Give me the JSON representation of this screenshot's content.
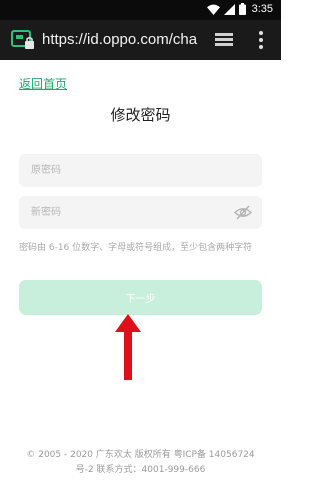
{
  "status_bar": {
    "time": "3:35",
    "icons": [
      "wifi-icon",
      "signal-icon",
      "battery-icon"
    ]
  },
  "browser": {
    "url": "https://id.oppo.com/chan",
    "icons": [
      "tab-switcher-icon",
      "reader-mode-icon",
      "overflow-menu-icon"
    ]
  },
  "page": {
    "back_link": "返回首页",
    "title": "修改密码",
    "old_password_placeholder": "原密码",
    "new_password_placeholder": "新密码",
    "hint": "密码由 6-16 位数字、字母或符号组成，至少包含两种字符",
    "next_label": "下一步"
  },
  "footer": {
    "line1": "© 2005 - 2020 广东欢太 版权所有 粤ICP备 14056724",
    "line2": "号-2 联系方式：4001-999-666"
  },
  "colors": {
    "accent": "#22a66b",
    "button_bg": "#c8efdc",
    "annotation_arrow": "#e0101a",
    "status_bar_bg": "#0b0b0b",
    "browser_bar_bg": "#1a1a1a",
    "field_bg": "#f4f4f4"
  }
}
